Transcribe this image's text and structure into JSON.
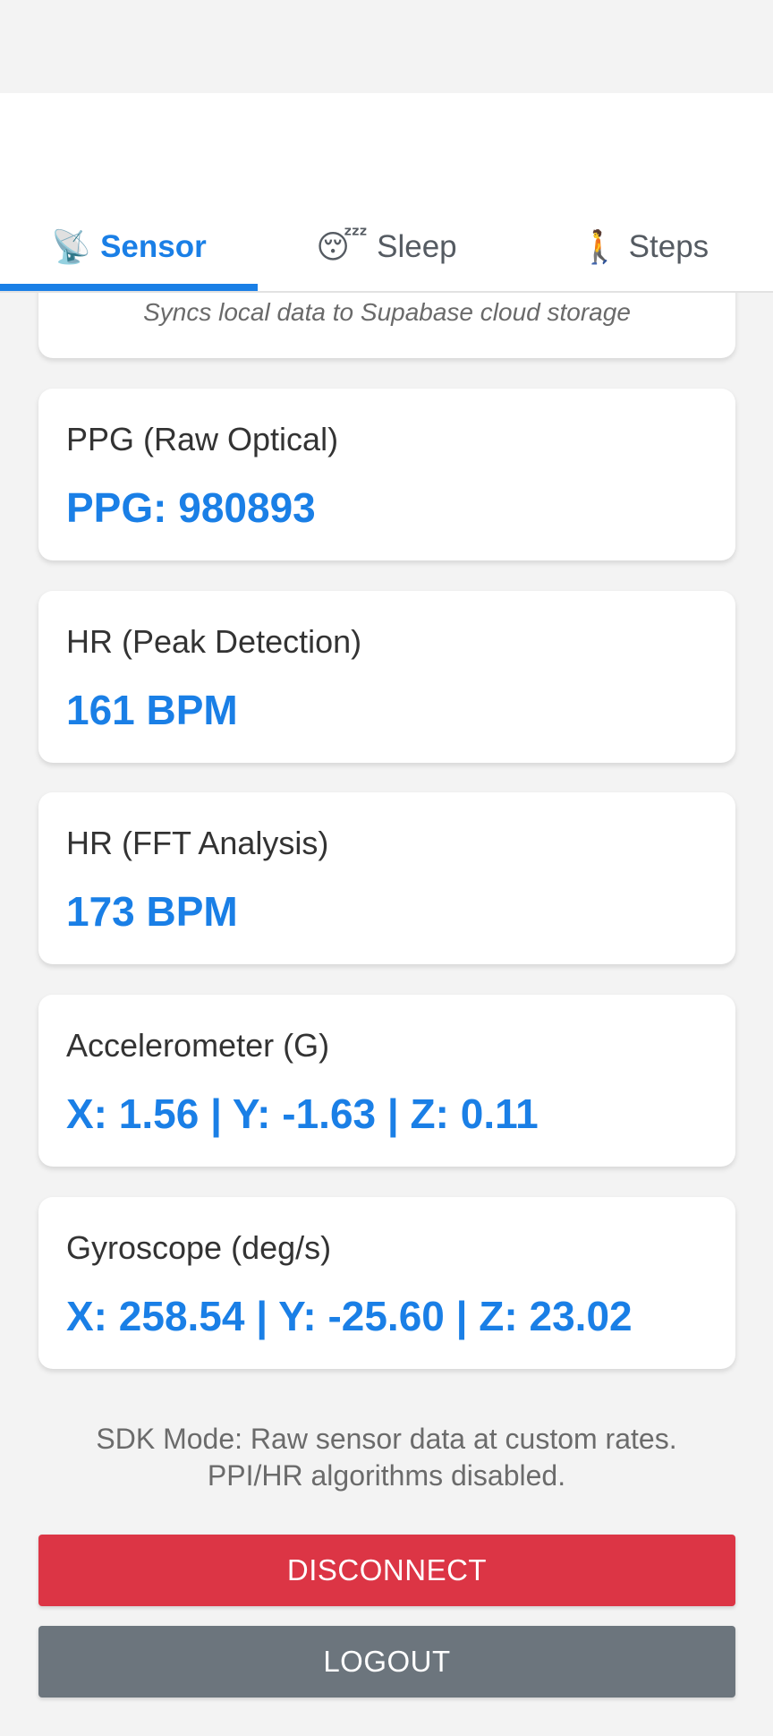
{
  "tabs": [
    {
      "icon": "📡",
      "label": "Sensor"
    },
    {
      "icon": "😴",
      "label": "Sleep"
    },
    {
      "icon": "🚶",
      "label": "Steps"
    }
  ],
  "active_tab": "Sensor",
  "sync_card": {
    "note": "Syncs local data to Supabase cloud storage"
  },
  "cards": [
    {
      "label": "PPG (Raw Optical)",
      "value": "PPG: 980893"
    },
    {
      "label": "HR (Peak Detection)",
      "value": "161 BPM"
    },
    {
      "label": "HR (FFT Analysis)",
      "value": "173 BPM"
    },
    {
      "label": "Accelerometer (G)",
      "value": "X: 1.56 | Y: -1.63 | Z: 0.11"
    },
    {
      "label": "Gyroscope (deg/s)",
      "value": "X: 258.54 | Y: -25.60 | Z: 23.02"
    }
  ],
  "sdk_note": "SDK Mode: Raw sensor data at custom rates. PPI/HR algorithms disabled.",
  "buttons": {
    "disconnect": "DISCONNECT",
    "logout": "LOGOUT"
  },
  "colors": {
    "accent": "#1a7fe6",
    "danger": "#dc3545",
    "secondary": "#6c757d"
  }
}
